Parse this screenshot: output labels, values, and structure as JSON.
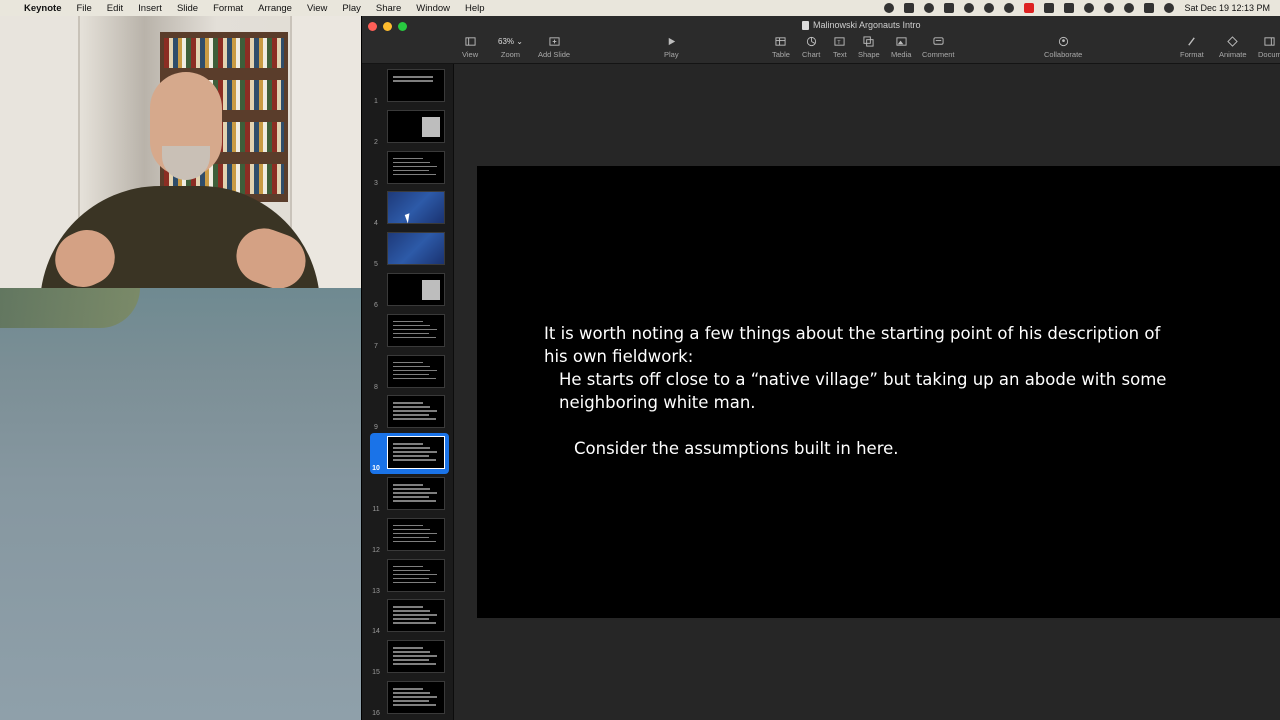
{
  "menubar": {
    "app": "Keynote",
    "items": [
      "File",
      "Edit",
      "Insert",
      "Slide",
      "Format",
      "Arrange",
      "View",
      "Play",
      "Share",
      "Window",
      "Help"
    ],
    "clock": "Sat Dec 19  12:13 PM"
  },
  "window": {
    "title": "Malinowski Argonauts Intro"
  },
  "toolbar": {
    "view": "View",
    "zoom_value": "63% ⌄",
    "zoom": "Zoom",
    "add_slide": "Add Slide",
    "play": "Play",
    "table": "Table",
    "chart": "Chart",
    "text": "Text",
    "shape": "Shape",
    "media": "Media",
    "comment": "Comment",
    "collaborate": "Collaborate",
    "format": "Format",
    "animate": "Animate",
    "document": "Docum"
  },
  "navigator": {
    "selected": 10,
    "slides": [
      {
        "n": "1",
        "kind": "title"
      },
      {
        "n": "2",
        "kind": "photo"
      },
      {
        "n": "3",
        "kind": "text"
      },
      {
        "n": "4",
        "kind": "map"
      },
      {
        "n": "5",
        "kind": "map"
      },
      {
        "n": "6",
        "kind": "photo"
      },
      {
        "n": "7",
        "kind": "text"
      },
      {
        "n": "8",
        "kind": "text"
      },
      {
        "n": "9",
        "kind": "text"
      },
      {
        "n": "10",
        "kind": "text"
      },
      {
        "n": "11",
        "kind": "text"
      },
      {
        "n": "12",
        "kind": "text"
      },
      {
        "n": "13",
        "kind": "text"
      },
      {
        "n": "14",
        "kind": "text"
      },
      {
        "n": "15",
        "kind": "text"
      },
      {
        "n": "16",
        "kind": "text"
      }
    ]
  },
  "slide": {
    "line1": "It is worth noting a few things about the starting point of his description of his own fieldwork:",
    "line2": "He starts off close to a “native village” but taking up an abode with some neighboring white man.",
    "line3": "Consider the assumptions built in here."
  },
  "colors": {
    "selection": "#1a73e8",
    "slide_bg": "#000000",
    "canvas_bg": "#262626"
  }
}
